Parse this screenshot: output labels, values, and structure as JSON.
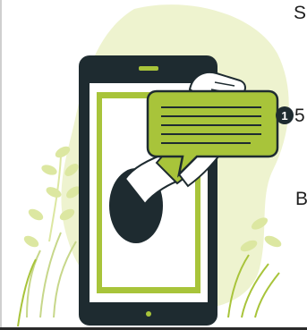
{
  "side_text": {
    "line1": "S",
    "line2": "5",
    "line3": "B"
  },
  "badge": {
    "count": "1"
  },
  "colors": {
    "accent_green": "#a8c43a",
    "light_green": "#dce7a1",
    "pale_green": "#eef3cf",
    "dark_navy": "#1e2b30",
    "white": "#ffffff"
  },
  "icons": [
    "smartphone-icon",
    "hand-icon",
    "chat-bubble-icon",
    "notification-badge-icon",
    "leaf-icon"
  ]
}
